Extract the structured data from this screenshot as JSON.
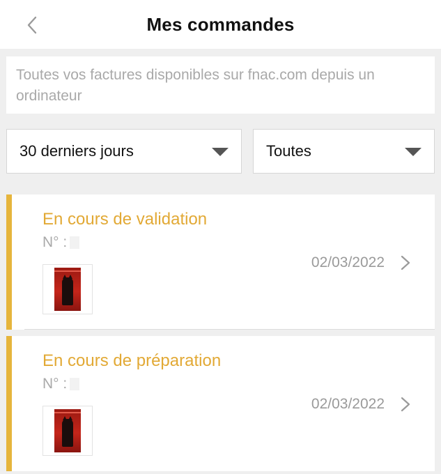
{
  "header": {
    "title": "Mes commandes",
    "back_icon": "chevron-left-icon"
  },
  "info_banner": {
    "text": "Toutes vos factures disponibles sur fnac.com depuis un ordinateur"
  },
  "filters": {
    "period": {
      "selected": "30 derniers jours",
      "icon": "caret-down-icon"
    },
    "status": {
      "selected": "Toutes",
      "icon": "caret-down-icon"
    }
  },
  "orders": [
    {
      "status": "En cours de validation",
      "number_label": "N° :",
      "date": "02/03/2022",
      "product_icon": "movie-poster-thumbnail"
    },
    {
      "status": "En cours de préparation",
      "number_label": "N° :",
      "date": "02/03/2022",
      "product_icon": "movie-poster-thumbnail"
    }
  ],
  "colors": {
    "accent": "#e6b53c",
    "status_text": "#e2a935",
    "background": "#efefef",
    "muted_text": "#a9a9a9"
  }
}
